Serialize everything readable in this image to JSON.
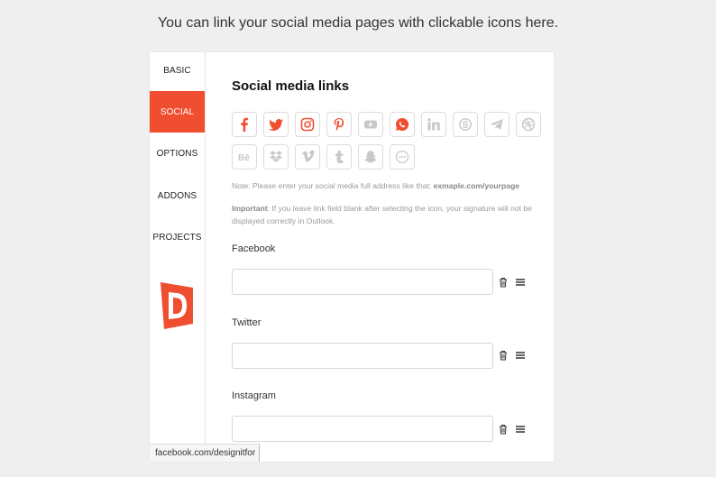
{
  "caption": "You can link your social media pages with clickable icons here.",
  "sidebar": {
    "items": [
      {
        "label": "BASIC",
        "active": false
      },
      {
        "label": "SOCIAL",
        "active": true
      },
      {
        "label": "OPTIONS",
        "active": false
      },
      {
        "label": "ADDONS",
        "active": false
      },
      {
        "label": "PROJECTS",
        "active": false
      }
    ],
    "logo_letter": "D"
  },
  "main": {
    "title": "Social media links",
    "icons_selected": [
      "facebook-icon",
      "twitter-icon",
      "instagram-icon",
      "pinterest-icon",
      "whatsapp-icon"
    ],
    "icons_unselected": [
      "youtube-icon",
      "linkedin-icon",
      "skype-icon",
      "telegram-icon",
      "dribbble-icon",
      "behance-icon",
      "dropbox-icon",
      "vimeo-icon",
      "tumblr-icon",
      "snapchat-icon",
      "more-icon"
    ],
    "note1_prefix": "Note: Please enter your social media full address like that: ",
    "note1_example": "exmaple.com/yourpage",
    "note2_label": "Important",
    "note2_text": ": If you leave link field blank after selecting the icon, your signature will not be displayed correctly in Outlook.",
    "fields": [
      {
        "label": "Facebook",
        "value": ""
      },
      {
        "label": "Twitter",
        "value": ""
      },
      {
        "label": "Instagram",
        "value": ""
      }
    ]
  },
  "status_url": "facebook.com/designitfor",
  "colors": {
    "accent": "#f04e30",
    "inactive_icon": "#c8c8c8"
  }
}
